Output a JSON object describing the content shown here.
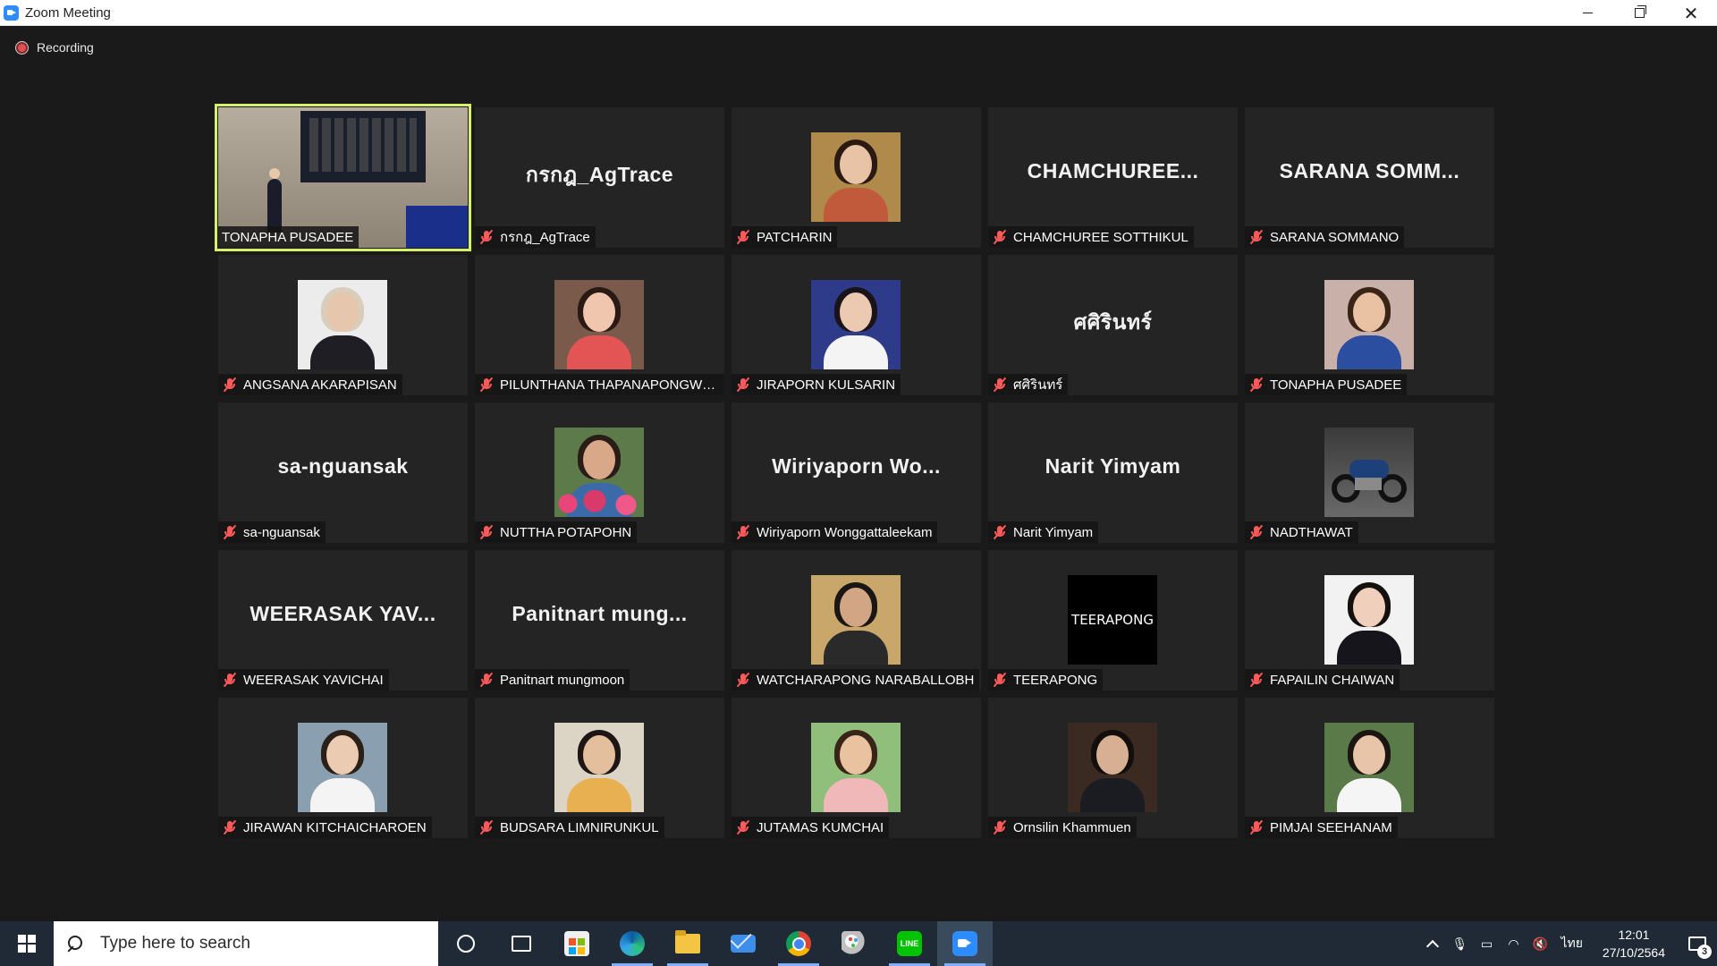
{
  "window": {
    "title": "Zoom Meeting"
  },
  "recording": {
    "label": "Recording"
  },
  "participants": [
    {
      "name": "TONAPHA PUSADEE",
      "display": "",
      "type": "room",
      "active": true,
      "muted": false
    },
    {
      "name": "กรกฎ_AgTrace",
      "display": "กรกฎ_AgTrace",
      "type": "text",
      "muted": true
    },
    {
      "name": "PATCHARIN",
      "display": "",
      "type": "photo",
      "skin": "#e8c3a5",
      "hair": "#2a1a12",
      "bg": "#b08a4a",
      "shirt": "#c05a3a",
      "muted": true
    },
    {
      "name": "CHAMCHUREE SOTTHIKUL",
      "display": "CHAMCHUREE...",
      "type": "text",
      "muted": true
    },
    {
      "name": "SARANA SOMMANO",
      "display": "SARANA  SOMM...",
      "type": "text",
      "muted": true
    },
    {
      "name": "ANGSANA AKARAPISAN",
      "display": "",
      "type": "photo",
      "skin": "#e6c7ad",
      "hair": "#d9cdbb",
      "bg": "#ececec",
      "shirt": "#1e1e24",
      "muted": true
    },
    {
      "name": "PILUNTHANA THAPANAPONGWO...",
      "display": "",
      "type": "photo",
      "skin": "#f0c6ae",
      "hair": "#2b1a14",
      "bg": "#7a5a4a",
      "shirt": "#e35555",
      "muted": true
    },
    {
      "name": "JIRAPORN KULSARIN",
      "display": "",
      "type": "photo",
      "skin": "#eccab2",
      "hair": "#1a1418",
      "bg": "#2e3a8a",
      "shirt": "#f4f4f4",
      "muted": true
    },
    {
      "name": "ศศิรินทร์",
      "display": "ศศิรินทร์",
      "type": "text",
      "muted": true
    },
    {
      "name": "TONAPHA PUSADEE",
      "display": "",
      "type": "photo",
      "skin": "#e8c2a2",
      "hair": "#3a2418",
      "bg": "#c9b0a8",
      "shirt": "#2c4ea0",
      "muted": true
    },
    {
      "name": "sa-nguansak",
      "display": "sa-nguansak",
      "type": "text",
      "muted": true
    },
    {
      "name": "NUTTHA POTAPOHN",
      "display": "",
      "type": "photo",
      "skin": "#d9a888",
      "hair": "#2a1c16",
      "bg": "#5c7a4a",
      "shirt": "#3a6aa8",
      "flowers": true,
      "muted": true
    },
    {
      "name": "Wiriyaporn Wonggattaleekam",
      "display": "Wiriyaporn  Wo...",
      "type": "text",
      "muted": true
    },
    {
      "name": "Narit Yimyam",
      "display": "Narit Yimyam",
      "type": "text",
      "muted": true
    },
    {
      "name": "NADTHAWAT",
      "display": "",
      "type": "moto",
      "muted": true
    },
    {
      "name": "WEERASAK YAVICHAI",
      "display": "WEERASAK  YAV...",
      "type": "text",
      "muted": true
    },
    {
      "name": "Panitnart mungmoon",
      "display": "Panitnart mung...",
      "type": "text",
      "muted": true
    },
    {
      "name": "WATCHARAPONG NARABALLOBH",
      "display": "",
      "type": "photo",
      "skin": "#d2a685",
      "hair": "#1a1614",
      "bg": "#c9a76a",
      "shirt": "#2a2a2a",
      "muted": true
    },
    {
      "name": "TEERAPONG",
      "display": "",
      "type": "teer",
      "logo_text": "TEERAPONG",
      "muted": true
    },
    {
      "name": "FAPAILIN CHAIWAN",
      "display": "",
      "type": "photo",
      "skin": "#f0d0bc",
      "hair": "#14100e",
      "bg": "#f2f2f2",
      "shirt": "#15151b",
      "muted": true
    },
    {
      "name": "JIRAWAN KITCHAICHAROEN",
      "display": "",
      "type": "photo",
      "skin": "#eccbb3",
      "hair": "#2b2018",
      "bg": "#8aa0b0",
      "shirt": "#f4f4f4",
      "muted": true
    },
    {
      "name": "BUDSARA LIMNIRUNKUL",
      "display": "",
      "type": "photo",
      "skin": "#e4bf9e",
      "hair": "#1e1614",
      "bg": "#dcd4c4",
      "shirt": "#e8b050",
      "muted": true
    },
    {
      "name": "JUTAMAS KUMCHAI",
      "display": "",
      "type": "photo",
      "skin": "#e9c2a0",
      "hair": "#3a2418",
      "bg": "#8fbf7a",
      "shirt": "#f0b8b8",
      "muted": true
    },
    {
      "name": "Ornsilin Khammuen",
      "display": "",
      "type": "photo",
      "skin": "#d7b093",
      "hair": "#120e0c",
      "bg": "#3a2a22",
      "shirt": "#1b1b22",
      "muted": true
    },
    {
      "name": "PIMJAI SEEHANAM",
      "display": "",
      "type": "photo",
      "skin": "#e8c5a8",
      "hair": "#1c1612",
      "bg": "#5a7a4a",
      "shirt": "#f5f5f5",
      "muted": true
    }
  ],
  "taskbar": {
    "search_placeholder": "Type here to search",
    "apps": [
      "cortana-icon",
      "task-view-icon",
      "store-icon",
      "edge-icon",
      "file-explorer-icon",
      "mail-icon",
      "chrome-icon",
      "paint-icon",
      "line-icon",
      "zoom-icon"
    ],
    "language": "ไทย",
    "time": "12:01",
    "date": "27/10/2564",
    "notification_count": "3"
  }
}
